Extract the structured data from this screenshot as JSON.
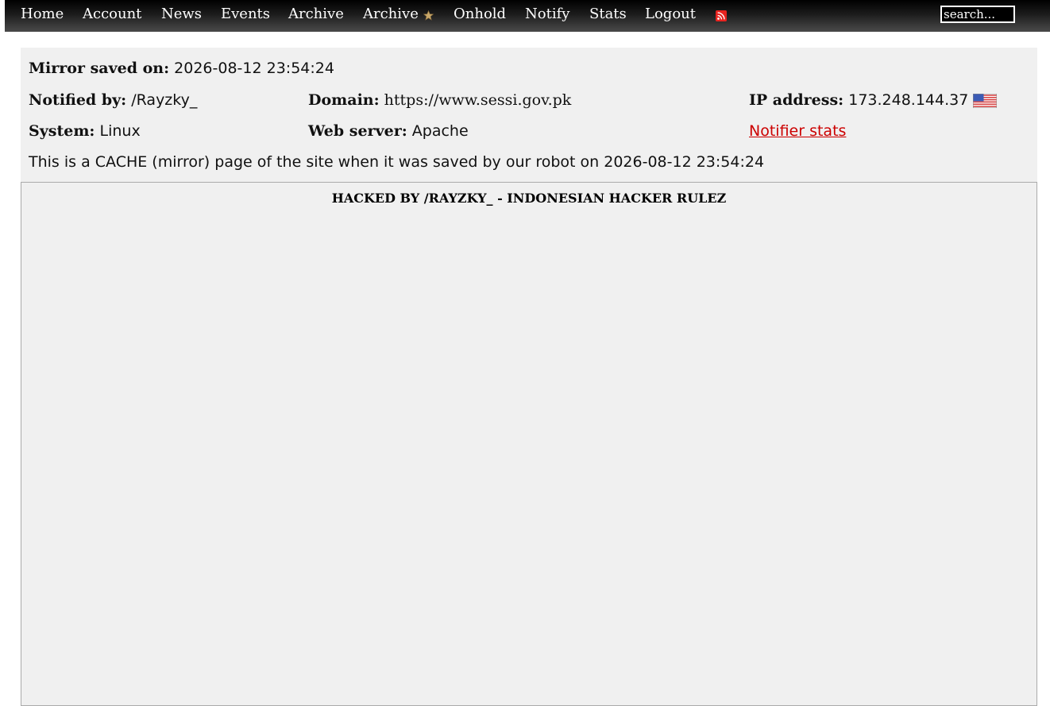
{
  "nav": {
    "items": [
      {
        "label": "Home"
      },
      {
        "label": "Account"
      },
      {
        "label": "News"
      },
      {
        "label": "Events"
      },
      {
        "label": "Archive"
      },
      {
        "label": "Archive"
      },
      {
        "label": "Onhold"
      },
      {
        "label": "Notify"
      },
      {
        "label": "Stats"
      },
      {
        "label": "Logout"
      }
    ],
    "star_icon": "star-icon",
    "rss_icon": "rss-icon",
    "search_placeholder": "search..."
  },
  "info": {
    "mirror_saved_label": "Mirror saved on:",
    "mirror_saved_value": "2026-08-12 23:54:24",
    "notified_by_label": "Notified by:",
    "notified_by_value": "/Rayzky_",
    "domain_label": "Domain:",
    "domain_value": "https://www.sessi.gov.pk",
    "ip_label": "IP address:",
    "ip_value": "173.248.144.37",
    "flag_icon": "us-flag-icon",
    "system_label": "System:",
    "system_value": "Linux",
    "web_server_label": "Web server:",
    "web_server_value": "Apache",
    "notifier_stats_link": "Notifier stats",
    "cache_note": "This is a CACHE (mirror) page of the site when it was saved by our robot on 2026-08-12 23:54:24"
  },
  "mirror": {
    "title": "HACKED BY /RAYZKY_ - INDONESIAN HACKER RULEZ"
  },
  "colors": {
    "link_red": "#cc0000",
    "panel_bg": "#f0f0f0",
    "rss_orange": "#e8231f"
  }
}
